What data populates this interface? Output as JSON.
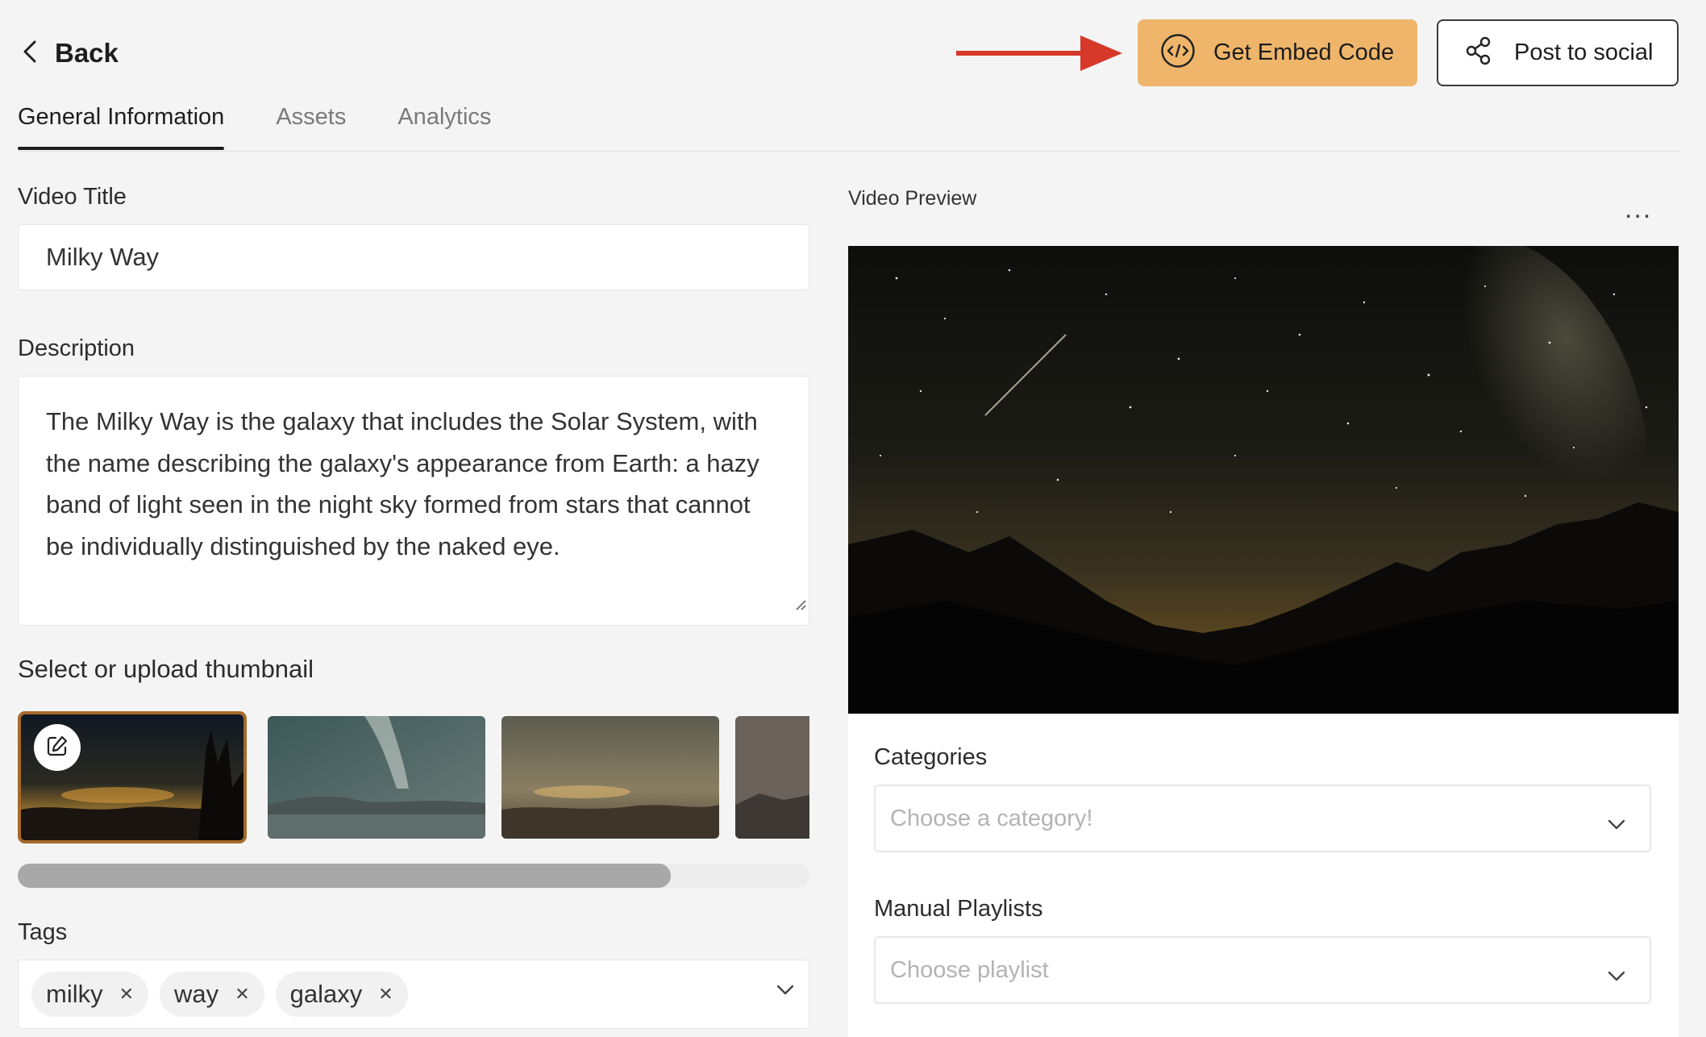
{
  "header": {
    "back_label": "Back",
    "embed_label": "Get Embed Code",
    "social_label": "Post to social",
    "annotation_arrow_color": "#d6382a",
    "embed_button_color": "#efb66b"
  },
  "tabs": [
    {
      "label": "General Information",
      "active": true
    },
    {
      "label": "Assets",
      "active": false
    },
    {
      "label": "Analytics",
      "active": false
    }
  ],
  "form": {
    "title_label": "Video Title",
    "title_value": "Milky Way",
    "description_label": "Description",
    "description_value": "The Milky Way is the galaxy that includes the Solar System, with the name describing the galaxy's appearance from Earth: a hazy band of light seen in the night sky formed from stars that cannot be individually distinguished by the naked eye.",
    "thumbnail_label": "Select or upload thumbnail",
    "thumbnail_count_visible": 4,
    "selected_thumbnail_index": 0,
    "tags_label": "Tags",
    "tags": [
      "milky",
      "way",
      "galaxy"
    ]
  },
  "preview": {
    "label": "Video Preview",
    "more_label": "..."
  },
  "categories": {
    "label": "Categories",
    "placeholder": "Choose a category!"
  },
  "playlists": {
    "label": "Manual Playlists",
    "placeholder": "Choose playlist"
  },
  "icons": {
    "back": "chevron-left-icon",
    "embed": "code-icon",
    "social": "share-icon",
    "edit": "edit-icon",
    "remove_tag": "close-icon",
    "dropdown": "chevron-down-icon"
  }
}
